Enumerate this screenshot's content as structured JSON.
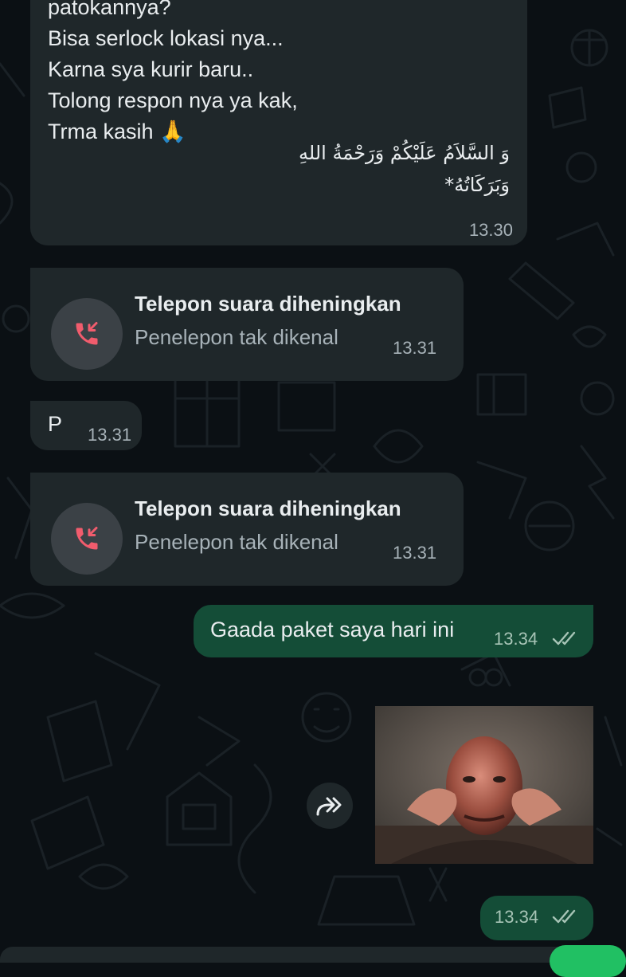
{
  "messages": {
    "long": {
      "lines": [
        "patokannya?",
        "Bisa serlock lokasi nya...",
        "Karna sya kurir baru..",
        "Tolong respon nya ya kak,",
        "Trma kasih 🙏"
      ],
      "arabic_line1": "وَ السَّلاَمُ عَلَيْكُمْ وَرَحْمَةُ اللهِ",
      "arabic_line2": "وَبَرَكَاتُهُ*",
      "time": "13.30"
    },
    "call1": {
      "title": "Telepon suara diheningkan",
      "subtitle": "Penelepon tak dikenal",
      "time": "13.31"
    },
    "p_msg": {
      "text": "P",
      "time": "13.31"
    },
    "call2": {
      "title": "Telepon suara diheningkan",
      "subtitle": "Penelepon tak dikenal",
      "time": "13.31"
    },
    "outgoing": {
      "text": "Gaada paket saya hari ini",
      "time": "13.34"
    },
    "image_msg": {
      "time": "13.34",
      "icon": "forward-icon"
    }
  },
  "colors": {
    "background": "#0b1014",
    "incoming_bubble": "#1f272a",
    "outgoing_bubble": "#144d37",
    "missed_call": "#f15c6d",
    "read_ticks": "#a7b2b8"
  }
}
